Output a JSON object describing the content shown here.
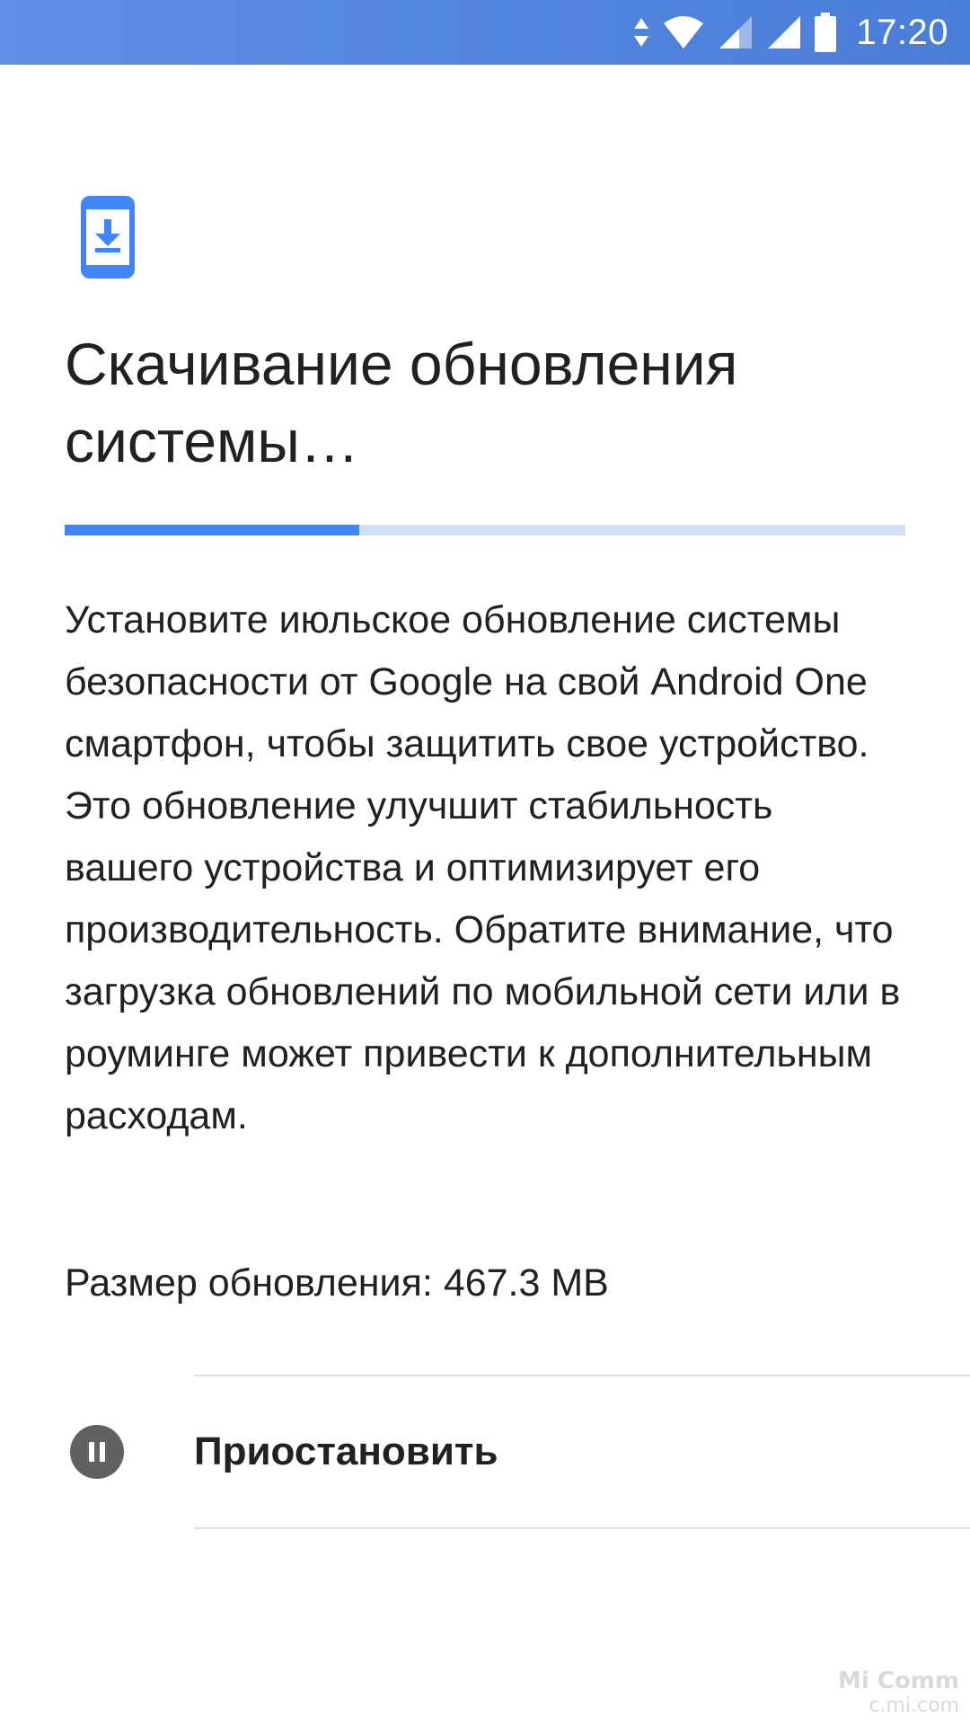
{
  "status_bar": {
    "time": "17:20",
    "icons": [
      "data-transfer-icon",
      "wifi-icon",
      "signal-icon",
      "signal-icon",
      "battery-icon"
    ]
  },
  "header": {
    "icon": "system-update-download-icon",
    "title": "Скачивание обновления системы…"
  },
  "progress": {
    "fraction": 0.35
  },
  "body": {
    "description": "Установите июльское обновление системы безопасности от Google на свой Android One смартфон, чтобы защитить свое устройство. Это обновление улучшит стабильность вашего устройства и оптимизирует его производительность. Обратите внимание, что загрузка обновлений по мобильной сети или в роуминге может привести к дополнительным расходам.",
    "size_label": "Размер обновления:",
    "size_value": "467.3 MB"
  },
  "actions": {
    "pause_label": "Приостановить",
    "pause_icon": "pause-icon"
  },
  "watermark": {
    "line1": "Mi Comm",
    "line2": "c.mi.com"
  },
  "colors": {
    "status_bar": "#4a7dd8",
    "accent": "#4285f4",
    "progress_track": "#cfe0f8",
    "pause_icon_bg": "#616161"
  }
}
